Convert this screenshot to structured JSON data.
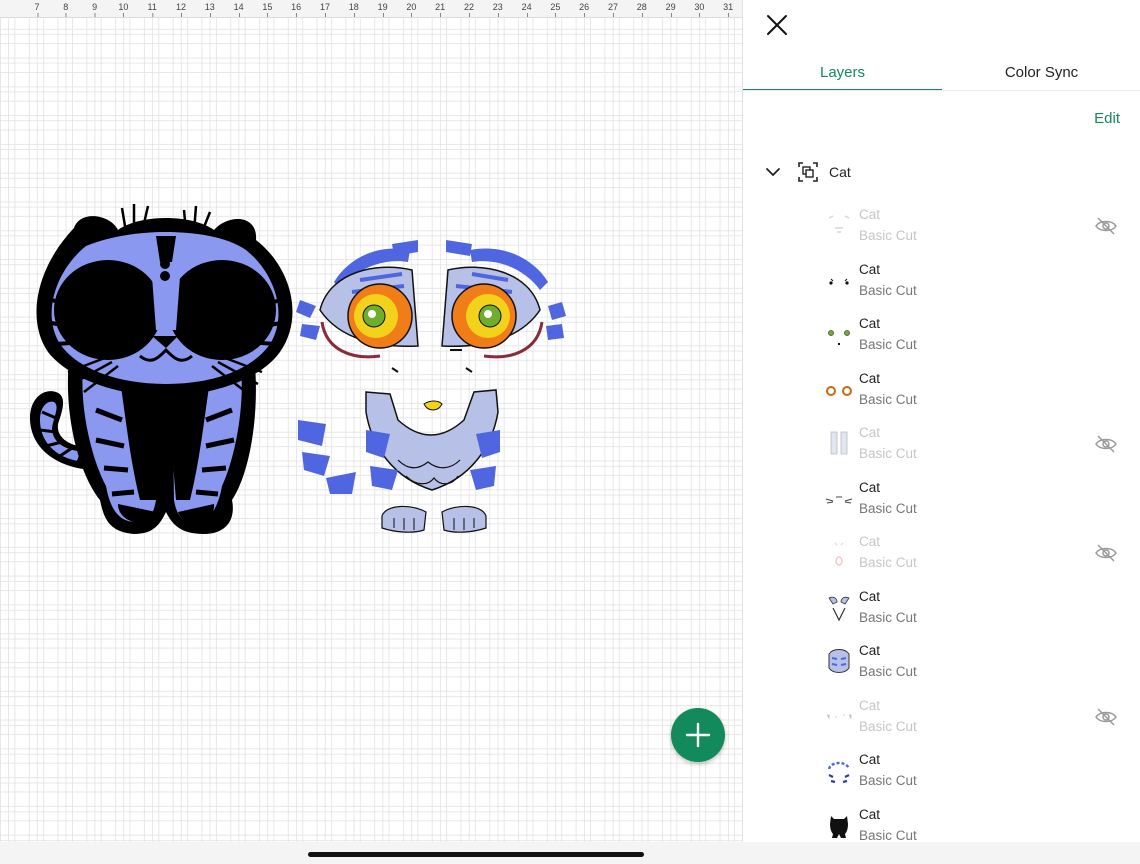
{
  "ruler": {
    "ticks": [
      "7",
      "8",
      "9",
      "10",
      "11",
      "12",
      "13",
      "14",
      "15",
      "16",
      "17",
      "18",
      "19",
      "20",
      "21",
      "22",
      "23",
      "24",
      "25",
      "26",
      "27",
      "28",
      "29",
      "30",
      "31"
    ]
  },
  "panel": {
    "tabs": [
      {
        "label": "Layers",
        "active": true
      },
      {
        "label": "Color Sync",
        "active": false
      }
    ],
    "edit_label": "Edit",
    "group": {
      "name": "Cat",
      "expanded": true
    },
    "layers": [
      {
        "name": "Cat",
        "type": "Basic Cut",
        "hidden": true,
        "thumb": "eyebrow-whiskers"
      },
      {
        "name": "Cat",
        "type": "Basic Cut",
        "hidden": false,
        "thumb": "eye-glints"
      },
      {
        "name": "Cat",
        "type": "Basic Cut",
        "hidden": false,
        "thumb": "green-pupils"
      },
      {
        "name": "Cat",
        "type": "Basic Cut",
        "hidden": false,
        "thumb": "orange-irises"
      },
      {
        "name": "Cat",
        "type": "Basic Cut",
        "hidden": true,
        "thumb": "legs"
      },
      {
        "name": "Cat",
        "type": "Basic Cut",
        "hidden": false,
        "thumb": "whisker-lines"
      },
      {
        "name": "Cat",
        "type": "Basic Cut",
        "hidden": true,
        "thumb": "nose-mouth"
      },
      {
        "name": "Cat",
        "type": "Basic Cut",
        "hidden": false,
        "thumb": "face-chest"
      },
      {
        "name": "Cat",
        "type": "Basic Cut",
        "hidden": false,
        "thumb": "body-stripes"
      },
      {
        "name": "Cat",
        "type": "Basic Cut",
        "hidden": true,
        "thumb": "small-marks"
      },
      {
        "name": "Cat",
        "type": "Basic Cut",
        "hidden": false,
        "thumb": "blue-markings"
      },
      {
        "name": "Cat",
        "type": "Basic Cut",
        "hidden": false,
        "thumb": "black-silhouette"
      }
    ]
  },
  "colors": {
    "accent": "#138a5b",
    "cat_blue": "#8b98f0",
    "cat_royal": "#5066e0",
    "cat_lavender": "#b7c0e6",
    "iris_orange": "#f07d18",
    "iris_yellow": "#f2d21a",
    "pupil_green": "#6fae2b"
  }
}
